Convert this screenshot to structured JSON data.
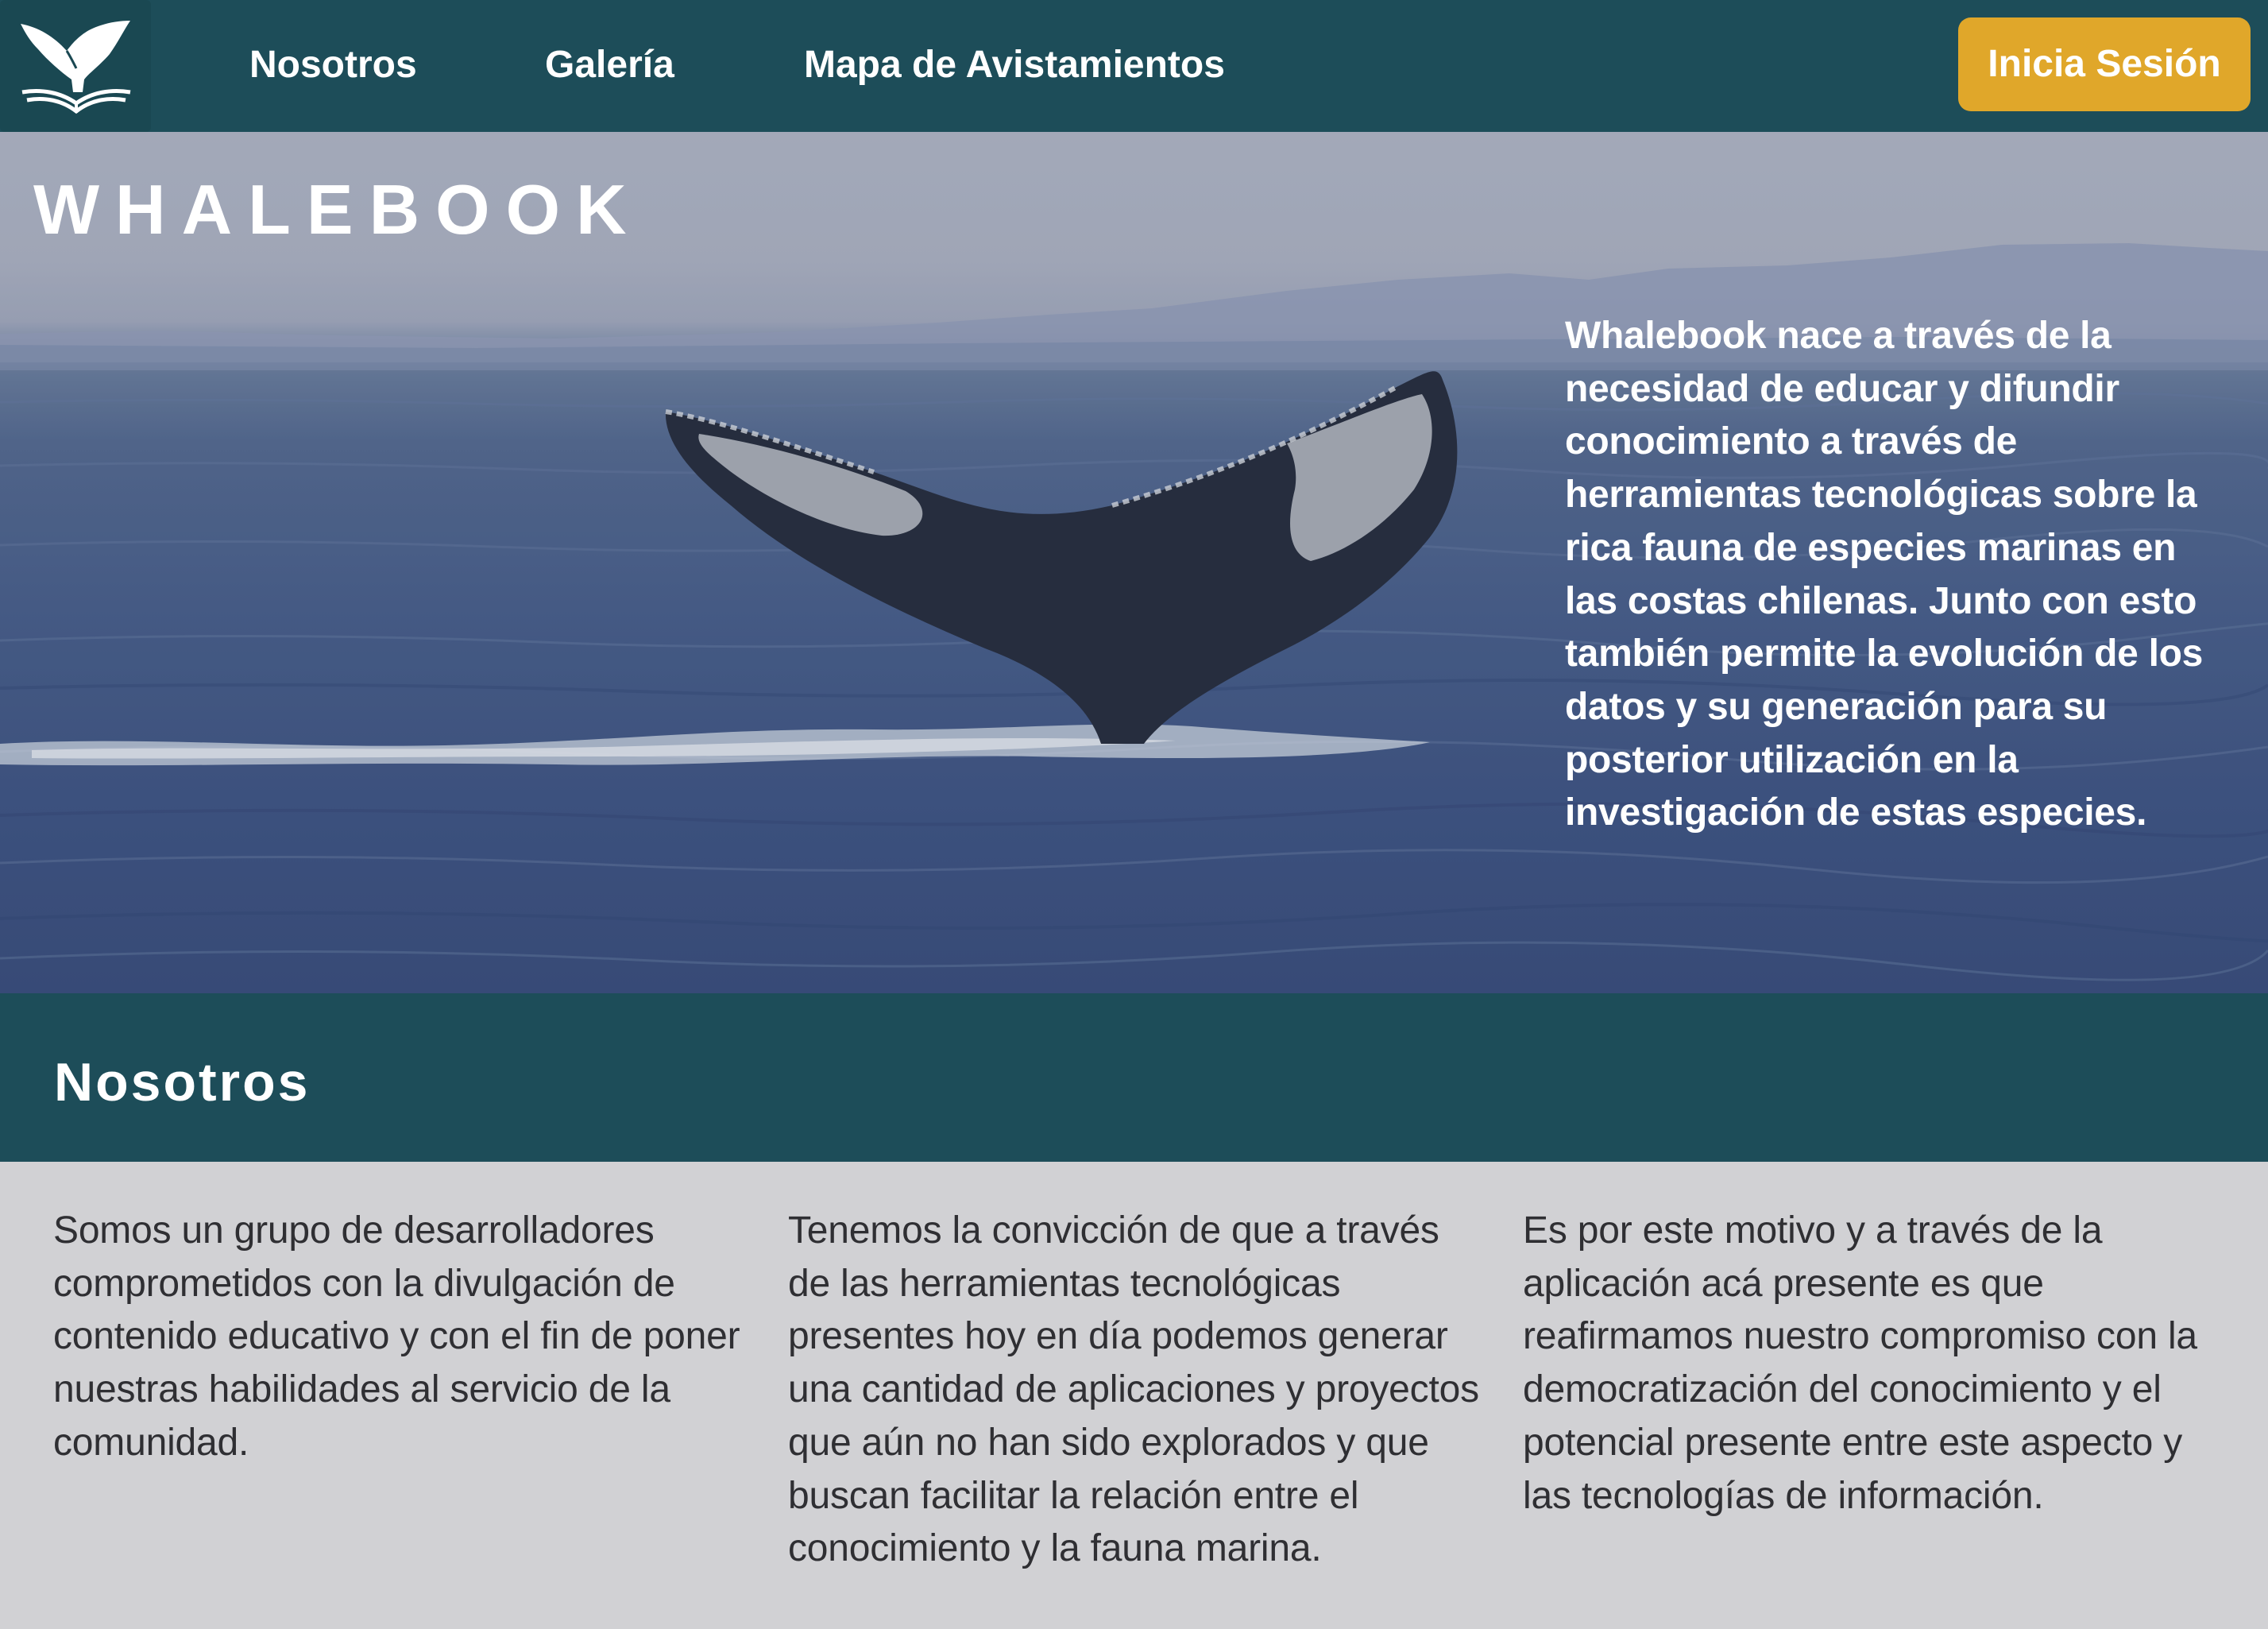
{
  "nav": {
    "logo_icon": "whale-tail-book-icon",
    "links": [
      "Nosotros",
      "Galería",
      "Mapa de Avistamientos"
    ],
    "login_label": "Inicia Sesión",
    "colors": {
      "bar": "#1d4d59",
      "login": "#e0a72a"
    }
  },
  "hero": {
    "brand": "WHALEBOOK",
    "image": "whale-tail-ocean-photo",
    "description": "Whalebook nace a través de la necesidad de educar y difundir conocimiento a través de herramientas tecnológicas sobre la rica fauna de especies marinas en las costas chilenas. Junto con esto también permite la evolución de los datos y su generación para su posterior utilización en la investigación de estas especies."
  },
  "about": {
    "title": "Nosotros",
    "columns": [
      "Somos un grupo de desarrolladores comprometidos con la divulgación de contenido educativo y con el fin de poner nuestras habilidades al servicio de la comunidad.",
      "Tenemos la convicción de que a través de las herramientas tecnológicas presentes hoy en día podemos generar una cantidad de aplicaciones y proyectos que aún no han sido explorados y que buscan facilitar la relación entre el conocimiento y la fauna marina.",
      "Es por este motivo y a través de la aplicación acá presente es que reafirmamos nuestro compromiso con la democratización del conocimiento y el potencial presente entre este aspecto y las tecnologías de información."
    ]
  }
}
